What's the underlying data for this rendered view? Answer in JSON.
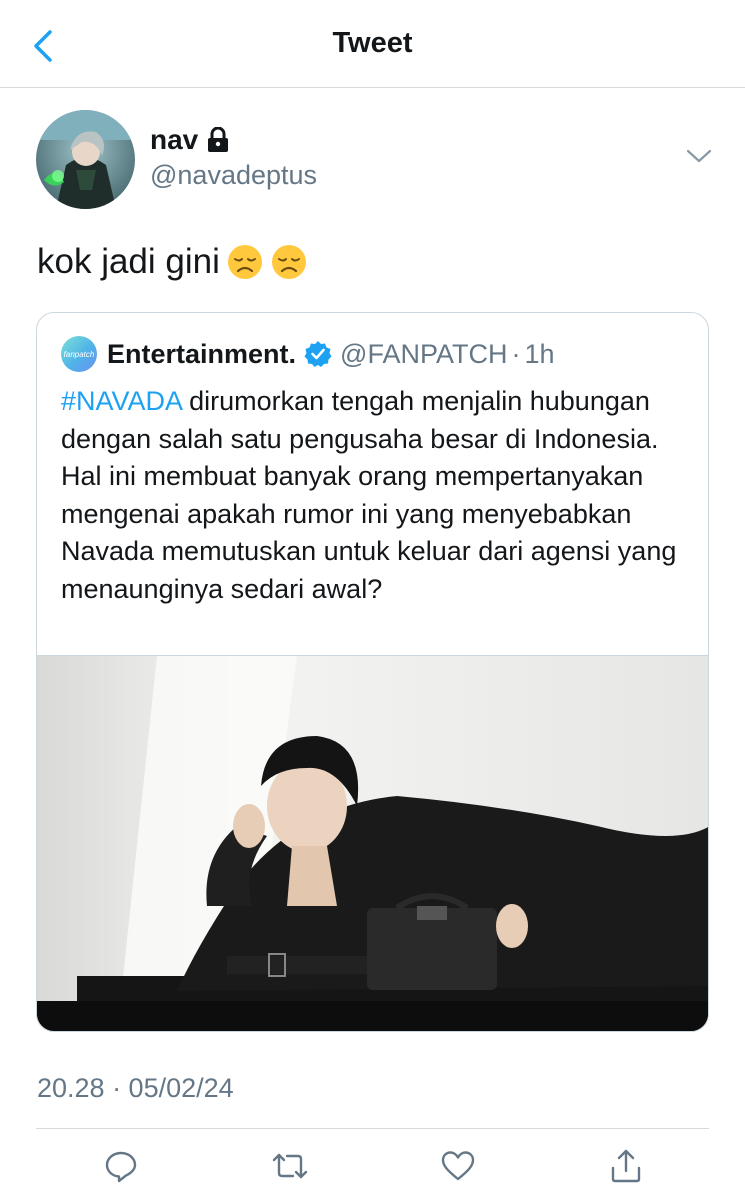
{
  "header": {
    "title": "Tweet",
    "back_icon": "chevron-left-icon"
  },
  "author": {
    "name": "nav",
    "handle": "@navadeptus",
    "locked_icon": "lock-icon"
  },
  "tweet": {
    "text": "kok jadi gini",
    "emojis": [
      "disappointed-face",
      "disappointed-face"
    ]
  },
  "quote": {
    "avatar_text": "fanpatch",
    "name": "Entertainment.",
    "verified_icon": "verified-badge-icon",
    "handle": "@FANPATCH",
    "separator": "·",
    "time": "1h",
    "hashtag": "#NAVADA",
    "text": " dirumorkan tengah menjalin hubungan dengan salah satu pengusaha besar di Indonesia. Hal ini membuat banyak orang mempertanyakan mengenai apakah rumor ini yang menyebabkan Navada memutuskan untuk keluar dari agensi yang menaunginya sedari awal?"
  },
  "meta": {
    "timestamp": "20.28 · 05/02/24"
  },
  "actions": [
    "reply-icon",
    "retweet-icon",
    "like-icon",
    "share-icon"
  ],
  "colors": {
    "accent": "#1da1f2",
    "text": "#14171a",
    "secondary": "#657786",
    "border": "#ccd6dd"
  }
}
